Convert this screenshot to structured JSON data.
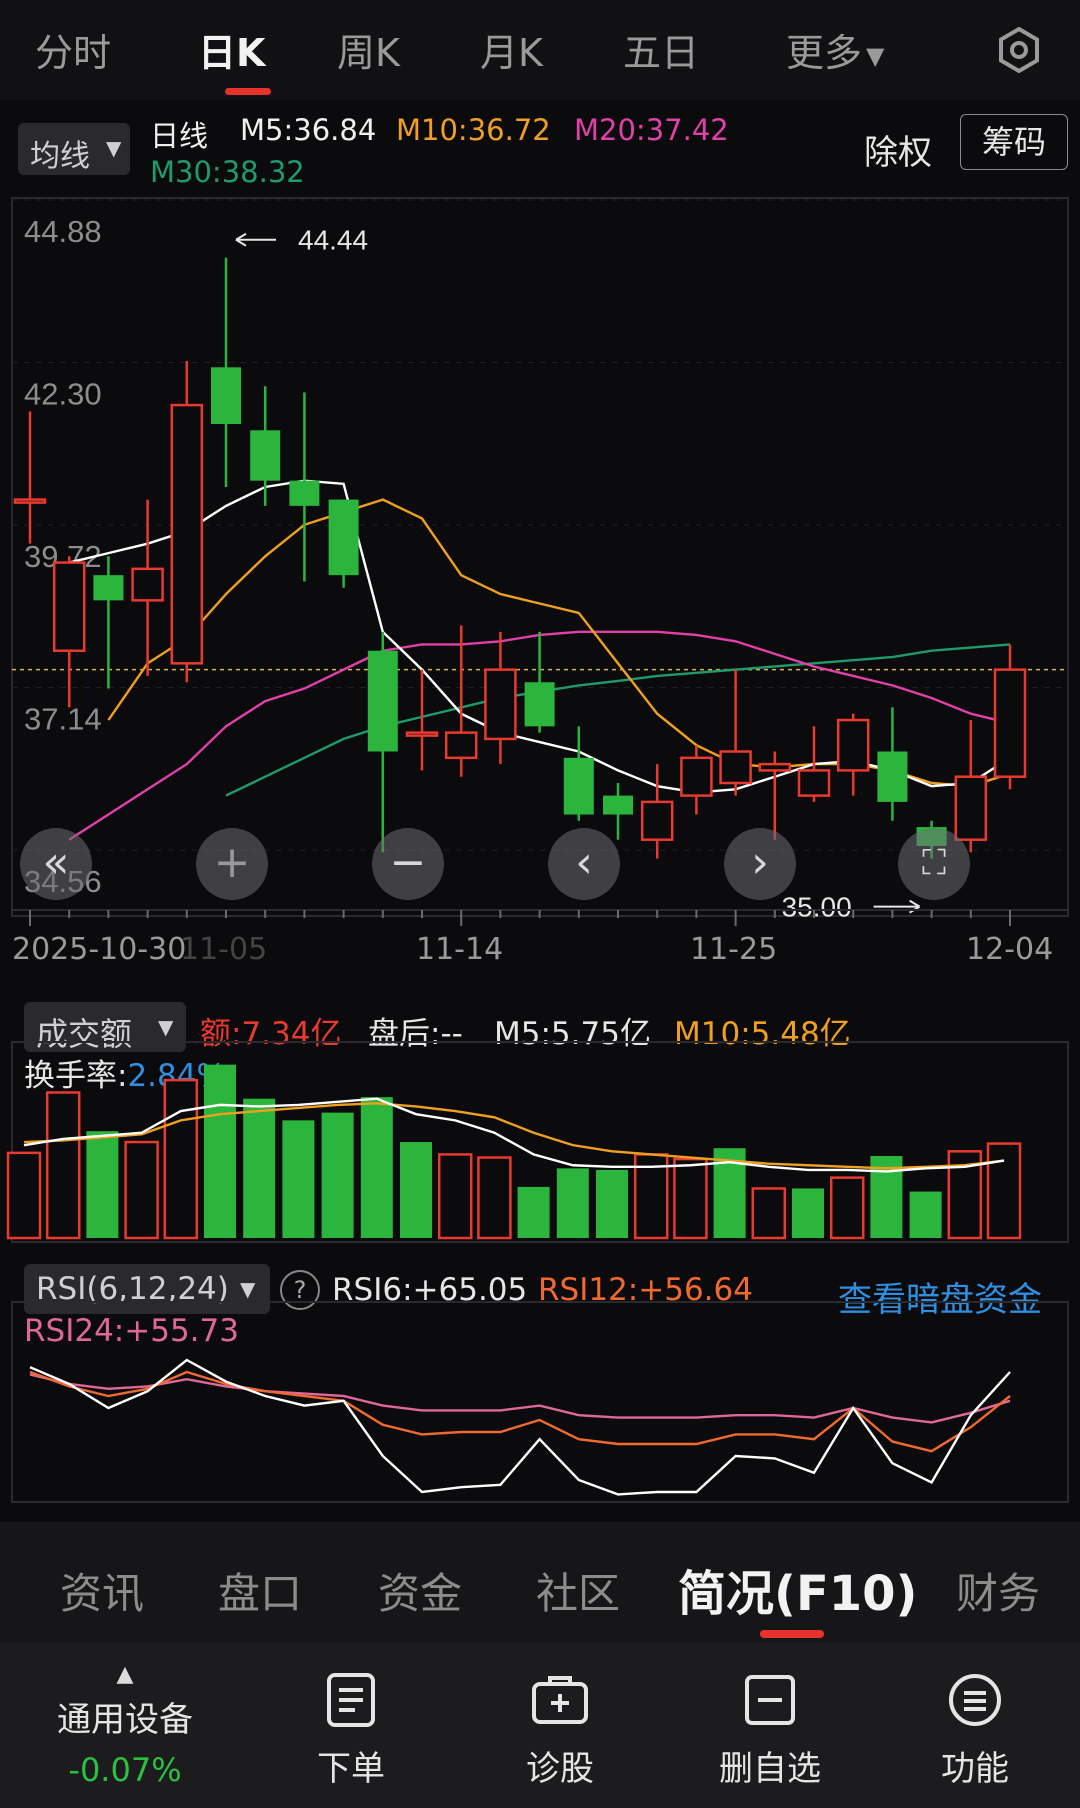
{
  "top_tabs": [
    {
      "label": "分时",
      "active": false
    },
    {
      "label": "日K",
      "active": true
    },
    {
      "label": "周K",
      "active": false
    },
    {
      "label": "月K",
      "active": false
    },
    {
      "label": "五日",
      "active": false
    },
    {
      "label": "更多",
      "active": false
    }
  ],
  "indicator_select": "均线",
  "ma_legend": {
    "period": "日线",
    "m5": "M5:36.84",
    "m10": "M10:36.72",
    "m20": "M20:37.42",
    "m30": "M30:38.32"
  },
  "chart_buttons": {
    "adjust": "除权",
    "chips": "筹码"
  },
  "colors": {
    "up": "#e83a2e",
    "down": "#2cb53c",
    "m5": "#ffffff",
    "m10": "#f0a020",
    "m20": "#e040a8",
    "m30": "#1f9a6a",
    "accent_blue": "#2f8fe0",
    "background": "#0b0b0d"
  },
  "price_axis": {
    "labels": [
      "44.88",
      "42.30",
      "39.72",
      "37.14",
      "34.56"
    ],
    "high_mark": "44.44",
    "low_mark": "35.00"
  },
  "date_axis": [
    "2025-10-30",
    "11-05",
    "11-14",
    "11-25",
    "12-04"
  ],
  "nav_controls": [
    "double-left-icon",
    "zoom-in-icon",
    "zoom-out-icon",
    "left-icon",
    "right-icon",
    "fullscreen-icon"
  ],
  "chart_data": {
    "type": "candlestick",
    "ylim": [
      34.56,
      44.88
    ],
    "candles": [
      {
        "o": 40.6,
        "c": 40.6,
        "h": 42.0,
        "l": 39.9
      },
      {
        "o": 38.2,
        "c": 39.6,
        "h": 39.7,
        "l": 37.3
      },
      {
        "o": 39.4,
        "c": 39.0,
        "h": 39.7,
        "l": 37.6
      },
      {
        "o": 39.0,
        "c": 39.5,
        "h": 40.6,
        "l": 37.8
      },
      {
        "o": 38.0,
        "c": 42.1,
        "h": 42.8,
        "l": 37.7
      },
      {
        "o": 42.7,
        "c": 41.8,
        "h": 44.44,
        "l": 40.8
      },
      {
        "o": 41.7,
        "c": 40.9,
        "h": 42.4,
        "l": 40.5
      },
      {
        "o": 40.9,
        "c": 40.5,
        "h": 42.3,
        "l": 39.3
      },
      {
        "o": 40.6,
        "c": 39.4,
        "h": 40.6,
        "l": 39.2
      },
      {
        "o": 38.2,
        "c": 36.6,
        "h": 38.5,
        "l": 35.0
      },
      {
        "o": 36.9,
        "c": 36.9,
        "h": 37.9,
        "l": 36.3
      },
      {
        "o": 36.5,
        "c": 36.9,
        "h": 38.6,
        "l": 36.2
      },
      {
        "o": 36.8,
        "c": 37.9,
        "h": 38.5,
        "l": 36.4
      },
      {
        "o": 37.7,
        "c": 37.0,
        "h": 38.5,
        "l": 36.9
      },
      {
        "o": 36.5,
        "c": 35.6,
        "h": 37.0,
        "l": 35.5
      },
      {
        "o": 35.9,
        "c": 35.6,
        "h": 36.1,
        "l": 35.2
      },
      {
        "o": 35.2,
        "c": 35.8,
        "h": 36.4,
        "l": 34.9
      },
      {
        "o": 35.9,
        "c": 36.5,
        "h": 36.7,
        "l": 35.6
      },
      {
        "o": 36.1,
        "c": 36.6,
        "h": 37.9,
        "l": 35.9
      },
      {
        "o": 36.3,
        "c": 36.4,
        "h": 36.6,
        "l": 35.2
      },
      {
        "o": 35.9,
        "c": 36.3,
        "h": 37.0,
        "l": 35.8
      },
      {
        "o": 36.3,
        "c": 37.1,
        "h": 37.2,
        "l": 35.9
      },
      {
        "o": 36.6,
        "c": 35.8,
        "h": 37.3,
        "l": 35.5
      },
      {
        "o": 35.4,
        "c": 35.1,
        "h": 35.5,
        "l": 34.9
      },
      {
        "o": 35.2,
        "c": 36.2,
        "h": 37.1,
        "l": 35.0
      },
      {
        "o": 36.2,
        "c": 37.9,
        "h": 38.3,
        "l": 36.0
      }
    ],
    "ma5": [
      39.6,
      39.75,
      39.9,
      40.1,
      40.5,
      40.8,
      40.9,
      40.85,
      38.5,
      37.9,
      37.2,
      36.9,
      36.75,
      36.6,
      36.3,
      36.05,
      35.95,
      36.0,
      36.2,
      36.4,
      36.45,
      36.3,
      36.05,
      36.1,
      36.5
    ],
    "ma10": [
      37.1,
      38.0,
      38.4,
      39.1,
      39.7,
      40.2,
      40.4,
      40.6,
      40.3,
      39.4,
      39.1,
      38.95,
      38.8,
      38.0,
      37.2,
      36.7,
      36.4,
      36.35,
      36.4,
      36.4,
      36.3,
      36.1,
      36.05,
      36.25
    ],
    "ma20": [
      35.2,
      35.6,
      36.0,
      36.4,
      37.0,
      37.4,
      37.6,
      37.9,
      38.2,
      38.3,
      38.3,
      38.35,
      38.45,
      38.5,
      38.5,
      38.5,
      38.45,
      38.35,
      38.15,
      37.95,
      37.8,
      37.65,
      37.45,
      37.2,
      37.05
    ],
    "ma30": [
      35.9,
      36.2,
      36.5,
      36.8,
      37.0,
      37.15,
      37.3,
      37.45,
      37.55,
      37.65,
      37.72,
      37.8,
      37.85,
      37.9,
      37.95,
      38.0,
      38.05,
      38.1,
      38.2,
      38.25,
      38.3
    ]
  },
  "volume_panel": {
    "select": "成交额",
    "amount": "额:7.34亿",
    "after_hours": "盘后:--",
    "m5": "M5:5.75亿",
    "m10": "M10:5.48亿",
    "turnover_label": "换手率:",
    "turnover_value": "2.84%"
  },
  "volume_data": {
    "values": [
      5.5,
      9.4,
      6.9,
      6.2,
      10.2,
      11.2,
      9.0,
      7.6,
      8.1,
      9.1,
      6.2,
      5.4,
      5.2,
      3.3,
      4.5,
      4.4,
      5.4,
      5.1,
      5.8,
      3.2,
      3.2,
      3.9,
      5.3,
      3.0,
      5.6,
      6.1
    ],
    "up": [
      true,
      true,
      false,
      true,
      true,
      false,
      false,
      false,
      false,
      false,
      false,
      true,
      true,
      false,
      false,
      false,
      true,
      true,
      false,
      true,
      false,
      true,
      false,
      false,
      true,
      true
    ],
    "m5": [
      6.0,
      6.4,
      6.6,
      6.8,
      8.2,
      8.6,
      8.5,
      8.6,
      8.8,
      9.0,
      8.0,
      7.6,
      6.8,
      5.4,
      4.7,
      4.6,
      4.6,
      4.7,
      4.9,
      4.6,
      4.4,
      4.4,
      4.3,
      4.5,
      4.6,
      5.0
    ],
    "m10": [
      6.2,
      6.3,
      6.5,
      6.7,
      7.6,
      8.0,
      8.2,
      8.4,
      8.6,
      8.7,
      8.5,
      8.2,
      7.8,
      6.8,
      6.0,
      5.6,
      5.4,
      5.2,
      5.0,
      4.8,
      4.7,
      4.6,
      4.5,
      4.6,
      4.7,
      5.0
    ]
  },
  "rsi_panel": {
    "select": "RSI(6,12,24)",
    "rsi6": "RSI6:+65.05",
    "rsi12": "RSI12:+56.64",
    "rsi24": "RSI24:+55.73",
    "link": "查看暗盘资金"
  },
  "rsi_data": {
    "rsi6": [
      72,
      65,
      55,
      62,
      75,
      66,
      60,
      56,
      58,
      35,
      20,
      22,
      23,
      42,
      25,
      19,
      20,
      20,
      35,
      34,
      28,
      55,
      32,
      24,
      52,
      70
    ],
    "rsi12": [
      70,
      64,
      60,
      63,
      70,
      65,
      62,
      60,
      58,
      48,
      44,
      45,
      45,
      50,
      42,
      40,
      40,
      40,
      44,
      44,
      42,
      55,
      41,
      37,
      47,
      60
    ],
    "rsi24": [
      69,
      65,
      63,
      64,
      67,
      64,
      62,
      61,
      60,
      56,
      54,
      54,
      54,
      56,
      52,
      51,
      51,
      51,
      52,
      52,
      51,
      55,
      51,
      49,
      53,
      58
    ]
  },
  "bottom_tabs": [
    {
      "label": "资讯",
      "active": false
    },
    {
      "label": "盘口",
      "active": false
    },
    {
      "label": "资金",
      "active": false
    },
    {
      "label": "社区",
      "active": false
    },
    {
      "label": "简况(F10)",
      "active": true
    },
    {
      "label": "财务",
      "active": false
    }
  ],
  "dock": {
    "sector_name": "通用设备",
    "sector_change": "-0.07%",
    "items": [
      {
        "label": "下单",
        "icon": "order-icon"
      },
      {
        "label": "诊股",
        "icon": "diagnose-icon"
      },
      {
        "label": "删自选",
        "icon": "remove-watchlist-icon"
      },
      {
        "label": "功能",
        "icon": "menu-icon"
      }
    ]
  }
}
